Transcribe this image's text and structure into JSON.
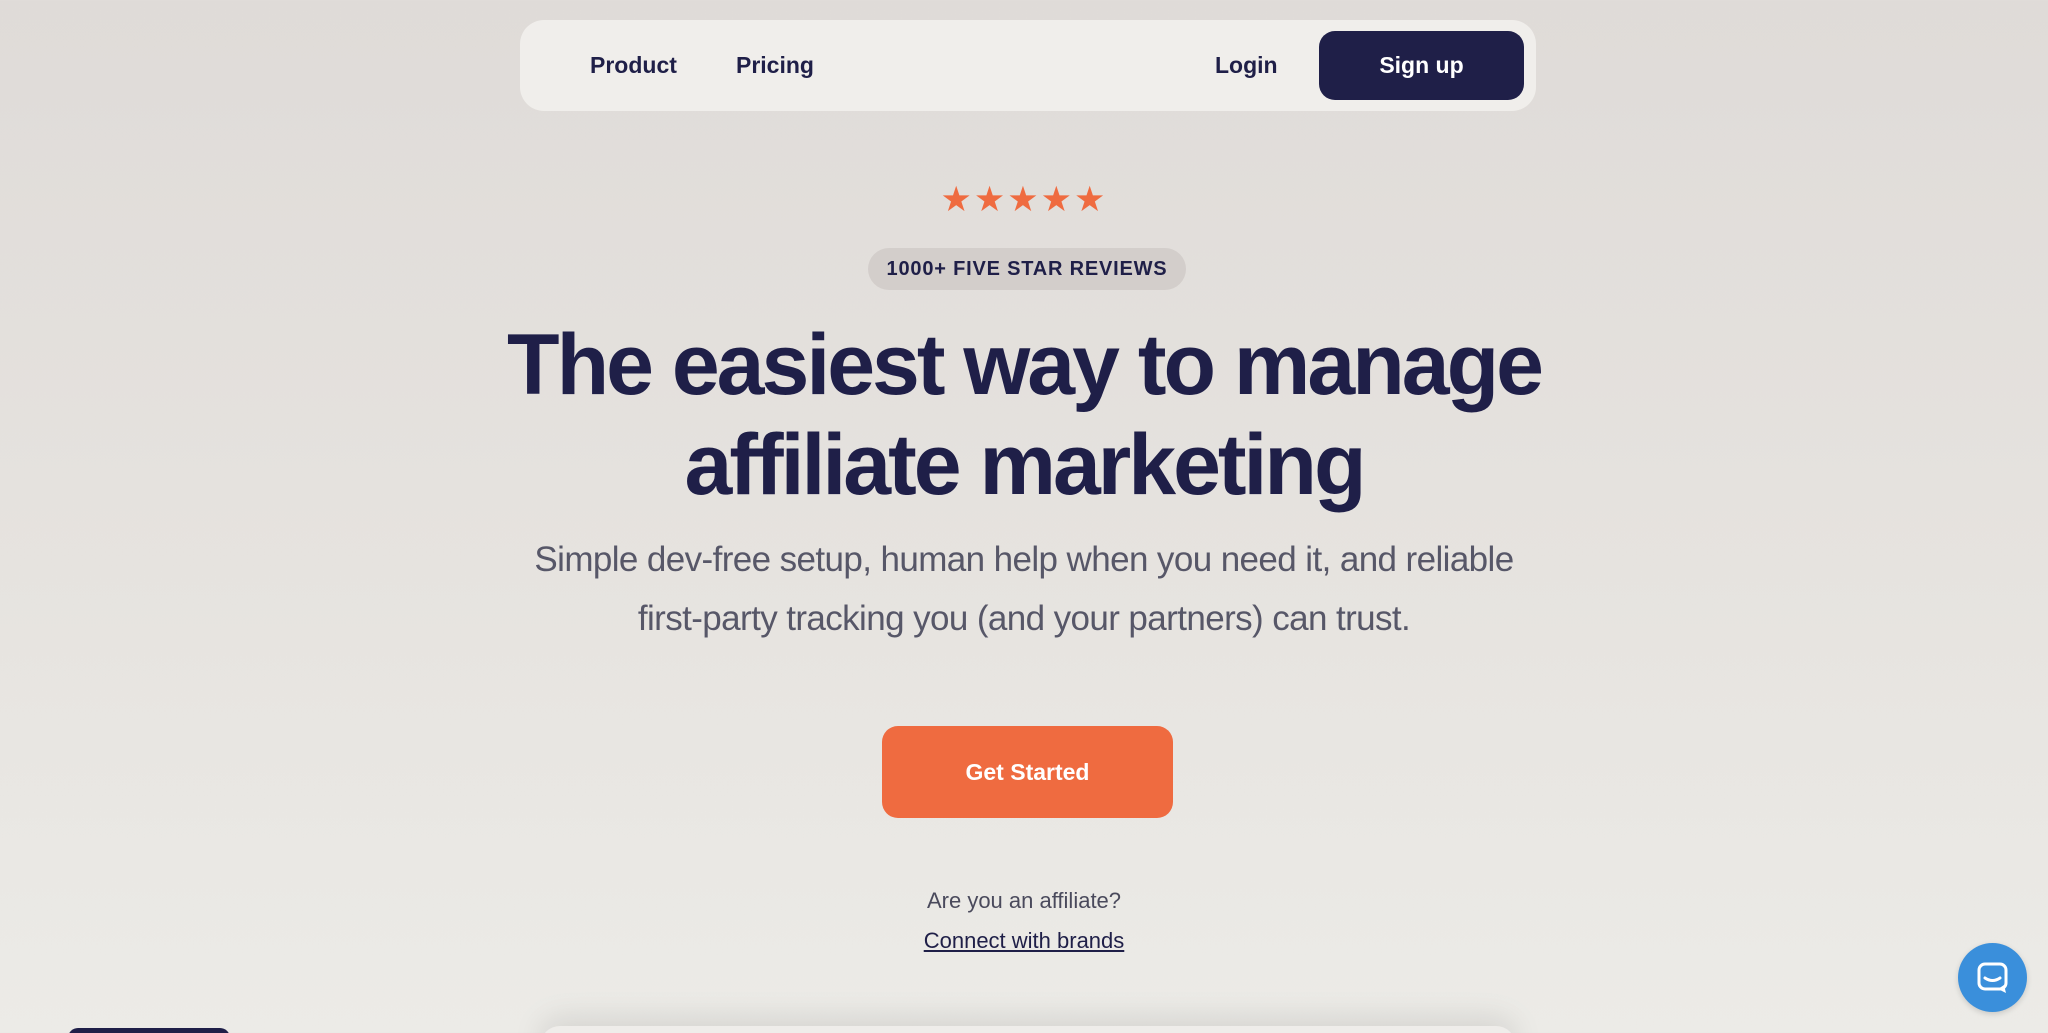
{
  "nav": {
    "product_label": "Product",
    "pricing_label": "Pricing",
    "login_label": "Login",
    "signup_label": "Sign up"
  },
  "hero": {
    "stars": "★★★★★",
    "rating": 5,
    "rating_max": 5,
    "badge": "1000+ FIVE STAR REVIEWS",
    "headline_line1": "The easiest way to manage",
    "headline_line2": "affiliate marketing",
    "subtitle_line1": "Simple dev-free setup, human help when you need it, and reliable",
    "subtitle_line2": "first-party tracking you (and your partners) can trust.",
    "cta_label": "Get Started",
    "affiliate_question": "Are you an affiliate?",
    "affiliate_link": "Connect with brands"
  },
  "chat": {
    "icon": "chat-icon"
  },
  "colors": {
    "navy": "#1f1f48",
    "accent_orange": "#ef6b40",
    "chat_blue": "#3a8fdb",
    "badge_bg": "#d3cecb"
  }
}
